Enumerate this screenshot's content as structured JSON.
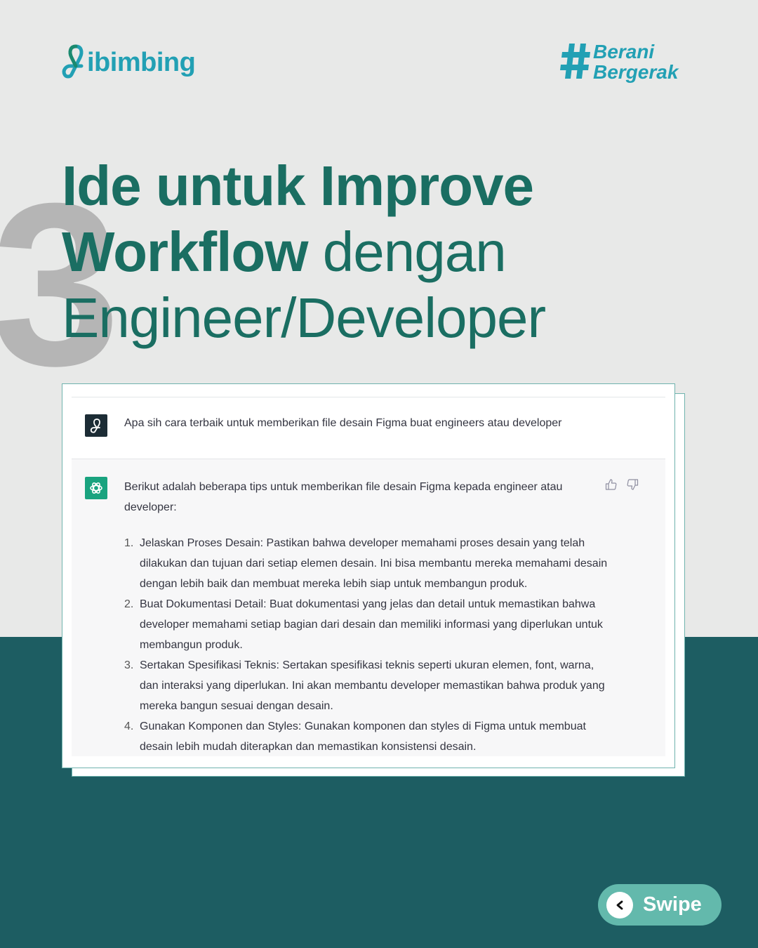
{
  "brand": {
    "logo_text": "ibimbing",
    "hashtag_symbol": "#",
    "hashtag_line1": "Berani",
    "hashtag_line2": "Bergerak",
    "accent_color": "#22a0b4"
  },
  "headline": {
    "number": "3",
    "line1": "Ide untuk Improve",
    "line2_bold": "Workflow",
    "line2_light": " dengan",
    "line3": "Engineer/Developer",
    "color": "#1a6e62"
  },
  "chat": {
    "user_message": "Apa sih cara terbaik untuk memberikan file desain Figma buat engineers atau developer",
    "assistant_intro": "Berikut adalah beberapa tips untuk memberikan file desain Figma kepada engineer atau developer:",
    "feedback_icons": [
      "thumbs-up-icon",
      "thumbs-down-icon"
    ],
    "steps": [
      {
        "num": "1.",
        "text": "Jelaskan Proses Desain: Pastikan bahwa developer memahami proses desain yang telah dilakukan dan tujuan dari setiap elemen desain. Ini bisa membantu mereka memahami desain dengan lebih baik dan membuat mereka lebih siap untuk membangun produk."
      },
      {
        "num": "2.",
        "text": "Buat Dokumentasi Detail: Buat dokumentasi yang jelas dan detail untuk memastikan bahwa developer memahami setiap bagian dari desain dan memiliki informasi yang diperlukan untuk membangun produk."
      },
      {
        "num": "3.",
        "text": "Sertakan Spesifikasi Teknis: Sertakan spesifikasi teknis seperti ukuran elemen, font, warna, dan interaksi yang diperlukan. Ini akan membantu developer memastikan bahwa produk yang mereka bangun sesuai dengan desain."
      },
      {
        "num": "4.",
        "text": "Gunakan Komponen dan Styles: Gunakan komponen dan styles di Figma untuk membuat desain lebih mudah diterapkan dan memastikan konsistensi desain."
      }
    ]
  },
  "swipe": {
    "arrow": "<",
    "label": "Swipe"
  }
}
